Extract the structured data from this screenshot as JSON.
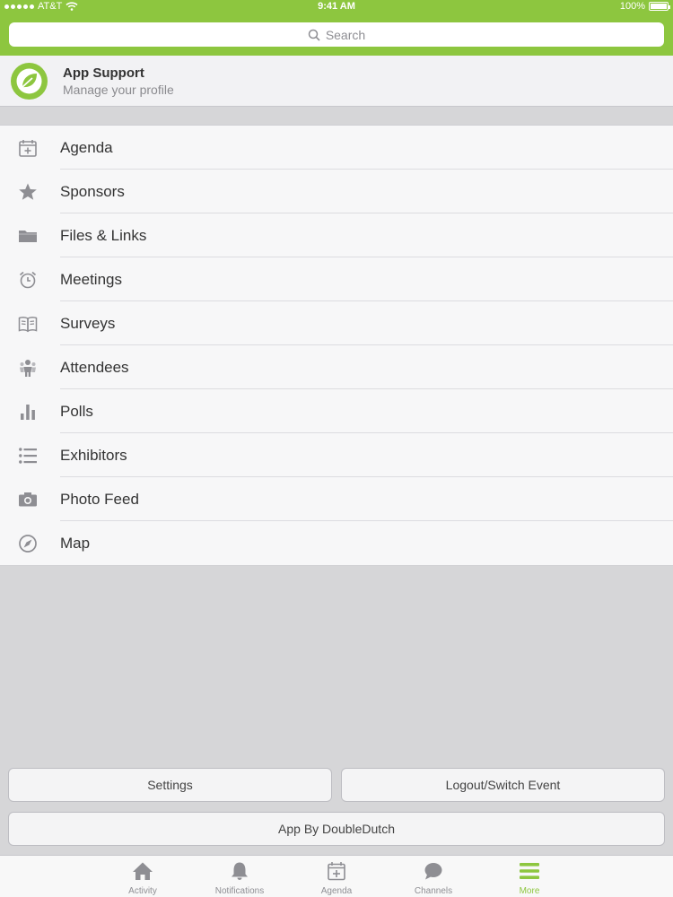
{
  "status_bar": {
    "carrier": "AT&T",
    "time": "9:41 AM",
    "battery": "100%"
  },
  "search": {
    "placeholder": "Search"
  },
  "profile": {
    "title": "App Support",
    "subtitle": "Manage your profile"
  },
  "menu": {
    "items": [
      {
        "label": "Agenda",
        "icon": "calendar-icon"
      },
      {
        "label": "Sponsors",
        "icon": "star-icon"
      },
      {
        "label": "Files & Links",
        "icon": "folder-icon"
      },
      {
        "label": "Meetings",
        "icon": "alarm-clock-icon"
      },
      {
        "label": "Surveys",
        "icon": "open-book-icon"
      },
      {
        "label": "Attendees",
        "icon": "people-icon"
      },
      {
        "label": "Polls",
        "icon": "bar-chart-icon"
      },
      {
        "label": "Exhibitors",
        "icon": "list-icon"
      },
      {
        "label": "Photo Feed",
        "icon": "camera-icon"
      },
      {
        "label": "Map",
        "icon": "compass-icon"
      }
    ]
  },
  "buttons": {
    "settings": "Settings",
    "logout": "Logout/Switch Event",
    "app_by": "App By DoubleDutch"
  },
  "tab_bar": {
    "tabs": [
      {
        "label": "Activity",
        "icon": "home-icon",
        "active": false
      },
      {
        "label": "Notifications",
        "icon": "bell-icon",
        "active": false
      },
      {
        "label": "Agenda",
        "icon": "calendar-icon",
        "active": false
      },
      {
        "label": "Channels",
        "icon": "chat-bubble-icon",
        "active": false
      },
      {
        "label": "More",
        "icon": "hamburger-menu-icon",
        "active": true
      }
    ]
  },
  "colors": {
    "accent": "#8dc63f",
    "icon_gray": "#8e8e93",
    "text": "#333333"
  }
}
